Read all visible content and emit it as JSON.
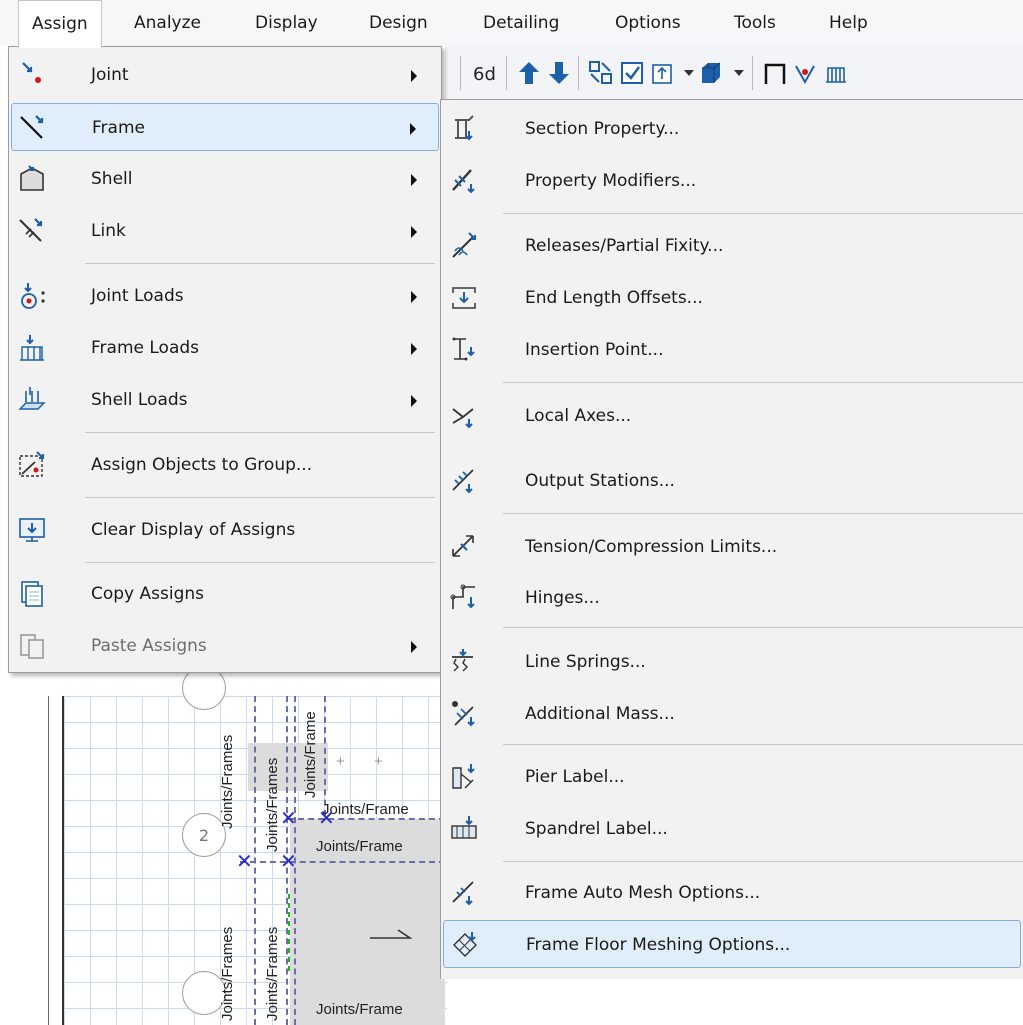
{
  "menubar": {
    "items": [
      "Assign",
      "Analyze",
      "Display",
      "Design",
      "Detailing",
      "Options",
      "Tools",
      "Help"
    ],
    "active_index": 0
  },
  "canvas": {
    "labels": {
      "joints_frames": "Joints/Frames",
      "joints_frame": "Joints/Frame",
      "joints_frame_short": "Joints/Frame",
      "circle_2": "2"
    }
  },
  "assign_menu": {
    "items": [
      {
        "label": "Joint",
        "icon": "joint-icon",
        "submenu": true
      },
      {
        "label": "Frame",
        "icon": "frame-icon",
        "submenu": true,
        "highlighted": true
      },
      {
        "label": "Shell",
        "icon": "shell-icon",
        "submenu": true
      },
      {
        "label": "Link",
        "icon": "link-icon",
        "submenu": true
      },
      {
        "label": "Joint Loads",
        "icon": "joint-loads-icon",
        "submenu": true
      },
      {
        "label": "Frame Loads",
        "icon": "frame-loads-icon",
        "submenu": true
      },
      {
        "label": "Shell Loads",
        "icon": "shell-loads-icon",
        "submenu": true
      },
      {
        "label": "Assign Objects to Group...",
        "icon": "group-icon",
        "submenu": false
      },
      {
        "label": "Clear Display of Assigns",
        "icon": "clear-display-icon",
        "submenu": false
      },
      {
        "label": "Copy Assigns",
        "icon": "copy-icon",
        "submenu": false
      },
      {
        "label": "Paste Assigns",
        "icon": "paste-icon",
        "submenu": true,
        "disabled": true
      }
    ]
  },
  "frame_submenu": {
    "items": [
      {
        "label": "Section Property...",
        "icon": "section-property-icon"
      },
      {
        "label": "Property Modifiers...",
        "icon": "property-modifiers-icon"
      },
      {
        "label": "Releases/Partial Fixity...",
        "icon": "releases-icon"
      },
      {
        "label": "End Length Offsets...",
        "icon": "end-length-offsets-icon"
      },
      {
        "label": "Insertion Point...",
        "icon": "insertion-point-icon"
      },
      {
        "label": "Local Axes...",
        "icon": "local-axes-icon"
      },
      {
        "label": "Output Stations...",
        "icon": "output-stations-icon"
      },
      {
        "label": "Tension/Compression Limits...",
        "icon": "tension-compression-icon"
      },
      {
        "label": "Hinges...",
        "icon": "hinges-icon"
      },
      {
        "label": "Line Springs...",
        "icon": "line-springs-icon"
      },
      {
        "label": "Additional Mass...",
        "icon": "additional-mass-icon"
      },
      {
        "label": "Pier Label...",
        "icon": "pier-label-icon"
      },
      {
        "label": "Spandrel Label...",
        "icon": "spandrel-label-icon"
      },
      {
        "label": "Frame Auto Mesh Options...",
        "icon": "auto-mesh-icon"
      },
      {
        "label": "Frame Floor Meshing Options...",
        "icon": "floor-meshing-icon",
        "highlighted": true
      }
    ]
  },
  "colors": {
    "highlight_fill": "#dfeefa",
    "highlight_border": "#7fb3e3",
    "icon_blue": "#1d5fa8",
    "icon_red": "#d01818"
  }
}
